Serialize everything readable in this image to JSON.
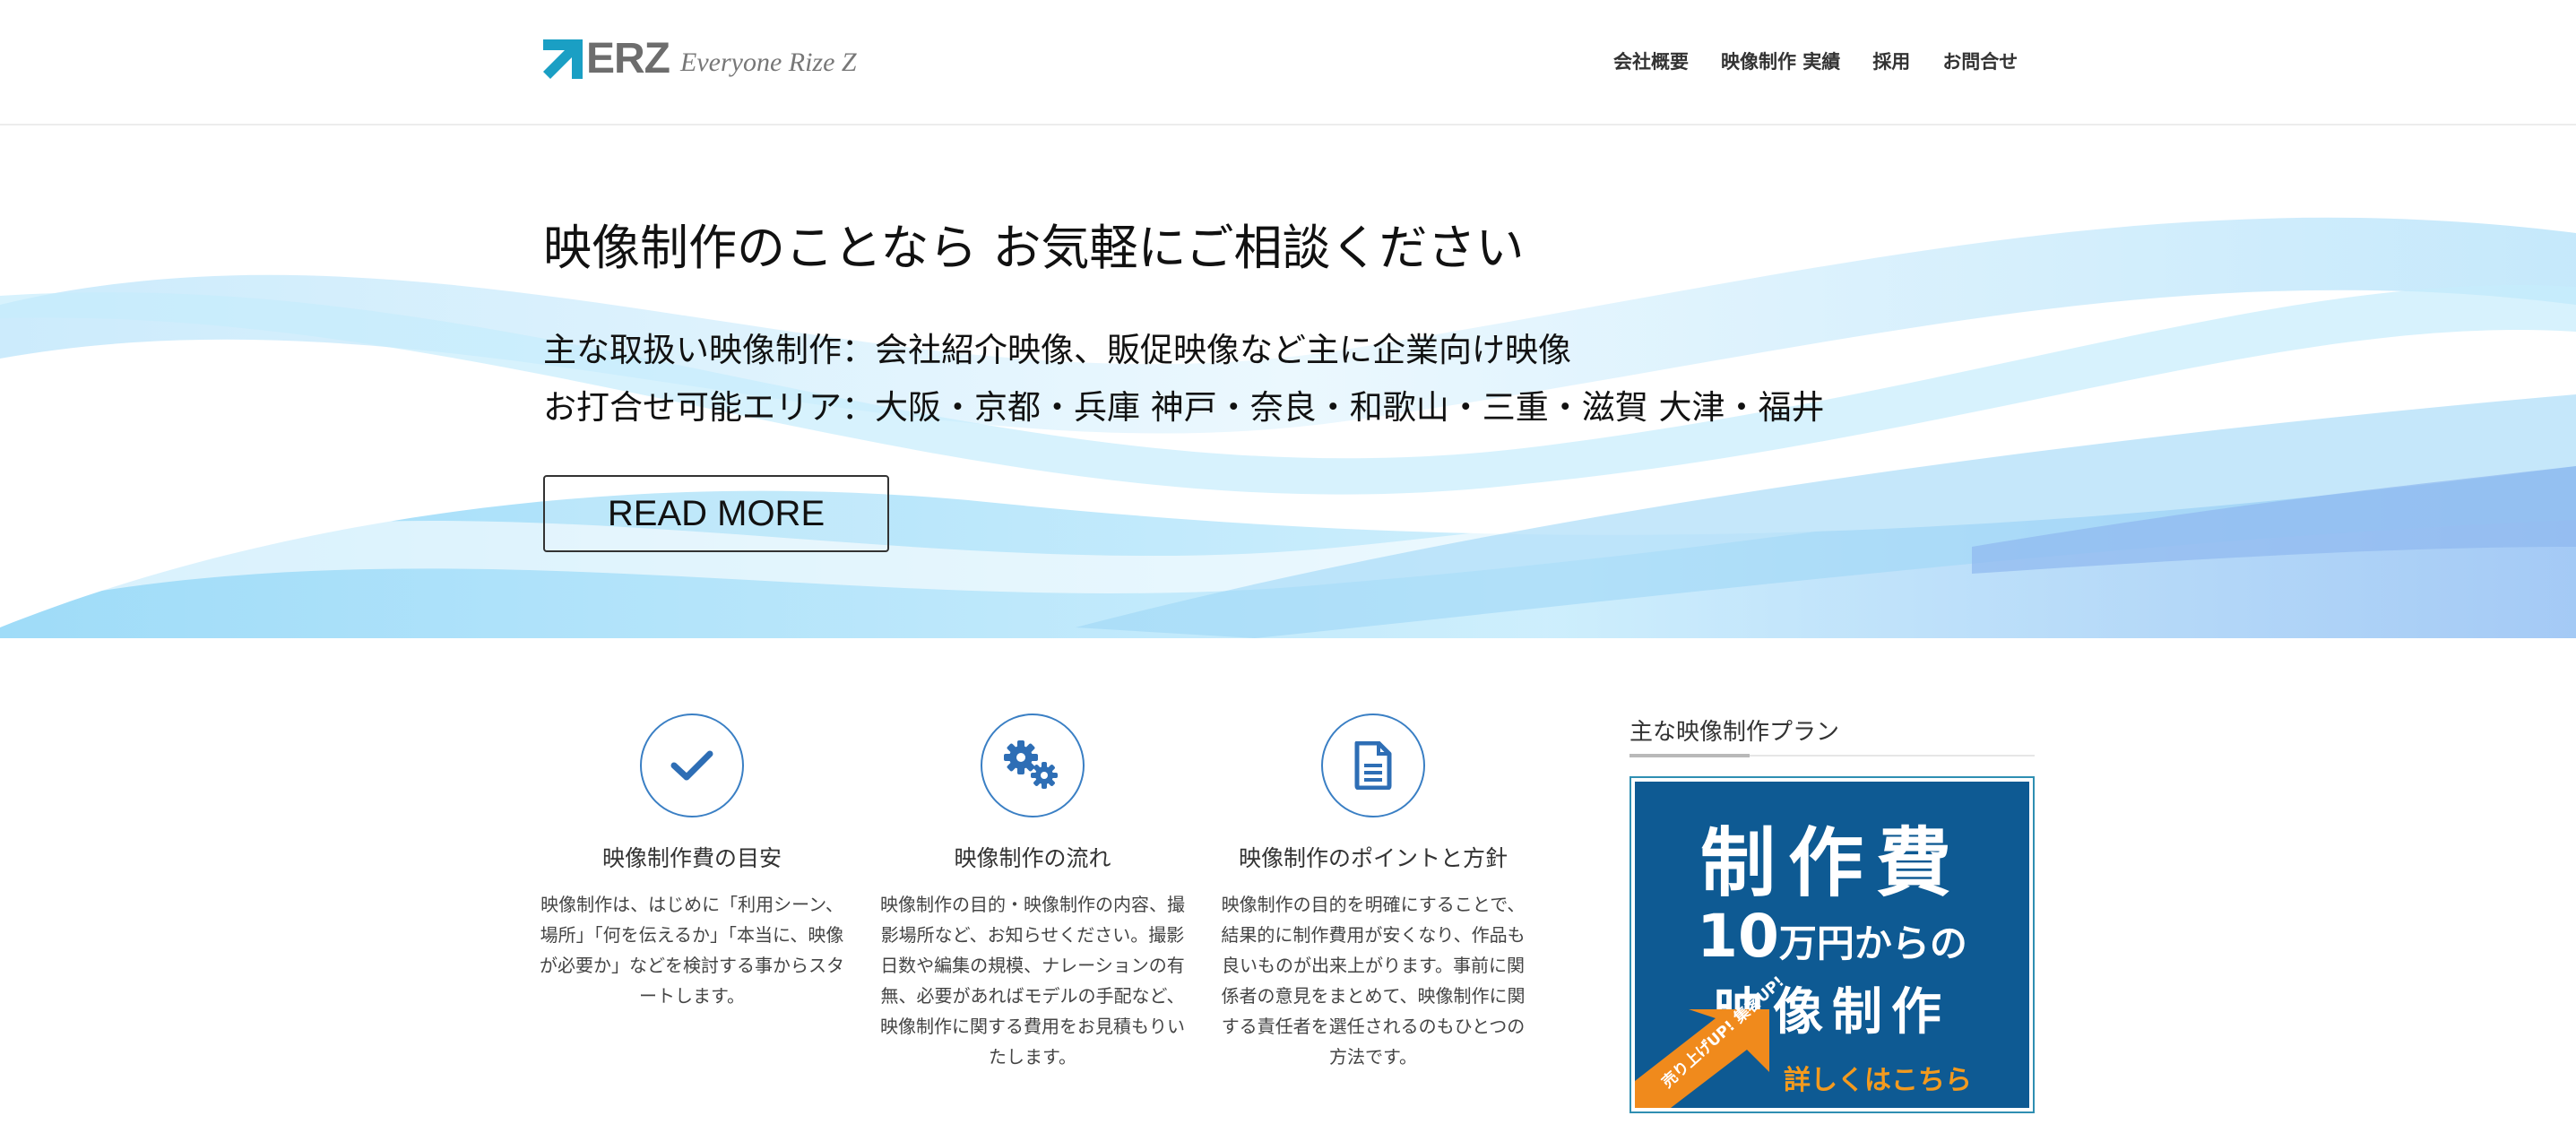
{
  "header": {
    "logo_text": "ERZ",
    "logo_tagline": "Everyone Rize Z",
    "nav": [
      "会社概要",
      "映像制作 実績",
      "採用",
      "お問合せ"
    ]
  },
  "hero": {
    "title": "映像制作のことなら お気軽にご相談ください",
    "line1": "主な取扱い映像制作：会社紹介映像、販促映像など主に企業向け映像",
    "line2": "お打合せ可能エリア：大阪・京都・兵庫 神戸・奈良・和歌山・三重・滋賀 大津・福井",
    "button_label": "READ MORE"
  },
  "features": [
    {
      "icon": "check-icon",
      "title": "映像制作費の目安",
      "text": "映像制作は、はじめに「利用シーン、場所」「何を伝えるか」「本当に、映像が必要か」などを検討する事からスタートします。"
    },
    {
      "icon": "gears-icon",
      "title": "映像制作の流れ",
      "text": "映像制作の目的・映像制作の内容、撮影場所など、お知らせください。撮影日数や編集の規模、ナレーションの有無、必要があればモデルの手配など、映像制作に関する費用をお見積もりいたします。"
    },
    {
      "icon": "document-icon",
      "title": "映像制作のポイントと方針",
      "text": "映像制作の目的を明確にすることで、結果的に制作費用が安くなり、作品も良いものが出来上がります。事前に関係者の意見をまとめて、映像制作に関する責任者を選任されるのもひとつの方法です。"
    }
  ],
  "sidebar": {
    "title": "主な映像制作プラン",
    "banner": {
      "line1": "制作費",
      "line2_number": "10",
      "line2_rest": "万円からの",
      "line3": "映像制作",
      "badge": "売り上げUP!\n集客UP!",
      "cta": "詳しくはこちら"
    }
  },
  "colors": {
    "accent_blue": "#3a7fc4",
    "banner_blue": "#0e5a93",
    "banner_orange": "#f39a1e",
    "logo_teal": "#1a9fc4"
  }
}
